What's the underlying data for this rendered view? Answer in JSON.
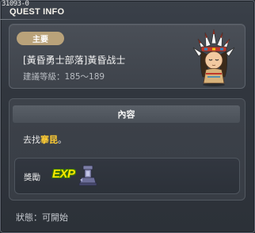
{
  "window": {
    "quest_id": "31093-0",
    "title": "QUEST INFO"
  },
  "header": {
    "badge": "主要",
    "quest_name": "[黃昏勇士部落]黃昏战士",
    "level_range": "建議等級：185～189"
  },
  "content": {
    "section_title": "內容",
    "desc_prefix": "去找",
    "desc_npc": "搴昆",
    "desc_suffix": "。",
    "reward_label": "獎勵",
    "exp_label": "EXP"
  },
  "status": {
    "text": "狀態：可開始"
  },
  "colors": {
    "badge": "#b9a27a",
    "npc_highlight": "#ffcc33",
    "exp": "#ffe700"
  },
  "icons": {
    "avatar": "chief-headdress-avatar",
    "exp": "exp-icon",
    "reward_item": "trophy-icon"
  }
}
